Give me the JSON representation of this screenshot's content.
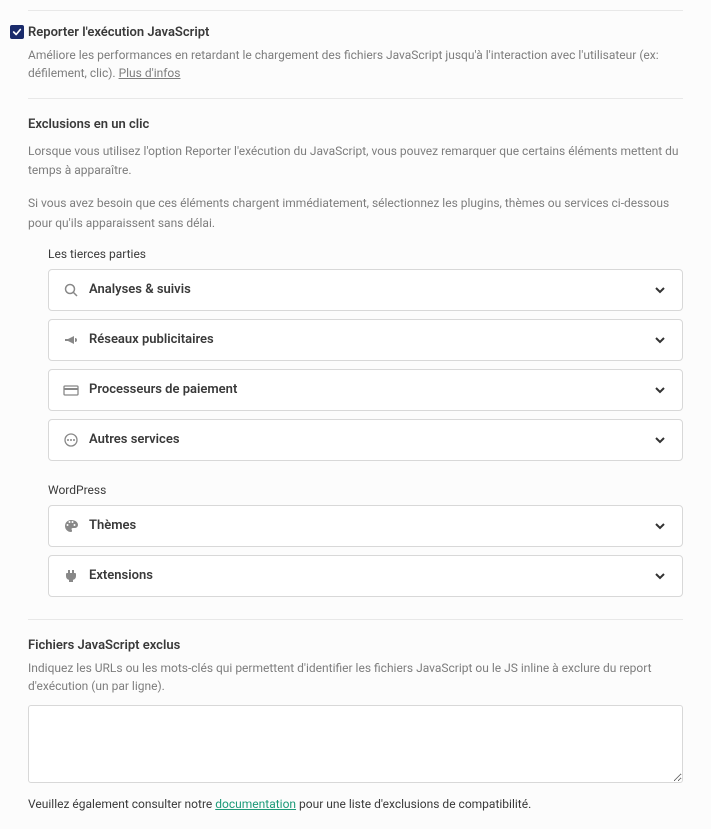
{
  "header": {
    "title": "Reporter l'exécution JavaScript",
    "description_prefix": "Améliore les performances en retardant le chargement des fichiers JavaScript jusqu'à l'interaction avec l'utilisateur (ex: défilement, clic). ",
    "more_info": "Plus d'infos"
  },
  "exclusions": {
    "title": "Exclusions en un clic",
    "desc1": "Lorsque vous utilisez l'option Reporter l'exécution du JavaScript, vous pouvez remarquer que certains éléments mettent du temps à apparaître.",
    "desc2": "Si vous avez besoin que ces éléments chargent immédiatement, sélectionnez les plugins, thèmes ou services ci-dessous pour qu'ils apparaissent sans délai."
  },
  "groups": {
    "third_party_label": "Les tierces parties",
    "third_party": [
      {
        "label": "Analyses & suivis",
        "icon": "search"
      },
      {
        "label": "Réseaux publicitaires",
        "icon": "megaphone"
      },
      {
        "label": "Processeurs de paiement",
        "icon": "card"
      },
      {
        "label": "Autres services",
        "icon": "dots"
      }
    ],
    "wordpress_label": "WordPress",
    "wordpress": [
      {
        "label": "Thèmes",
        "icon": "palette"
      },
      {
        "label": "Extensions",
        "icon": "plug"
      }
    ]
  },
  "excluded_files": {
    "title": "Fichiers JavaScript exclus",
    "desc": "Indiquez les URLs ou les mots-clés qui permettent d'identifier les fichiers JavaScript ou le JS inline à exclure du report d'exécution (un par ligne).",
    "note_prefix": "Veuillez également consulter notre ",
    "note_link": "documentation",
    "note_suffix": " pour une liste d'exclusions de compatibilité.",
    "value": ""
  }
}
